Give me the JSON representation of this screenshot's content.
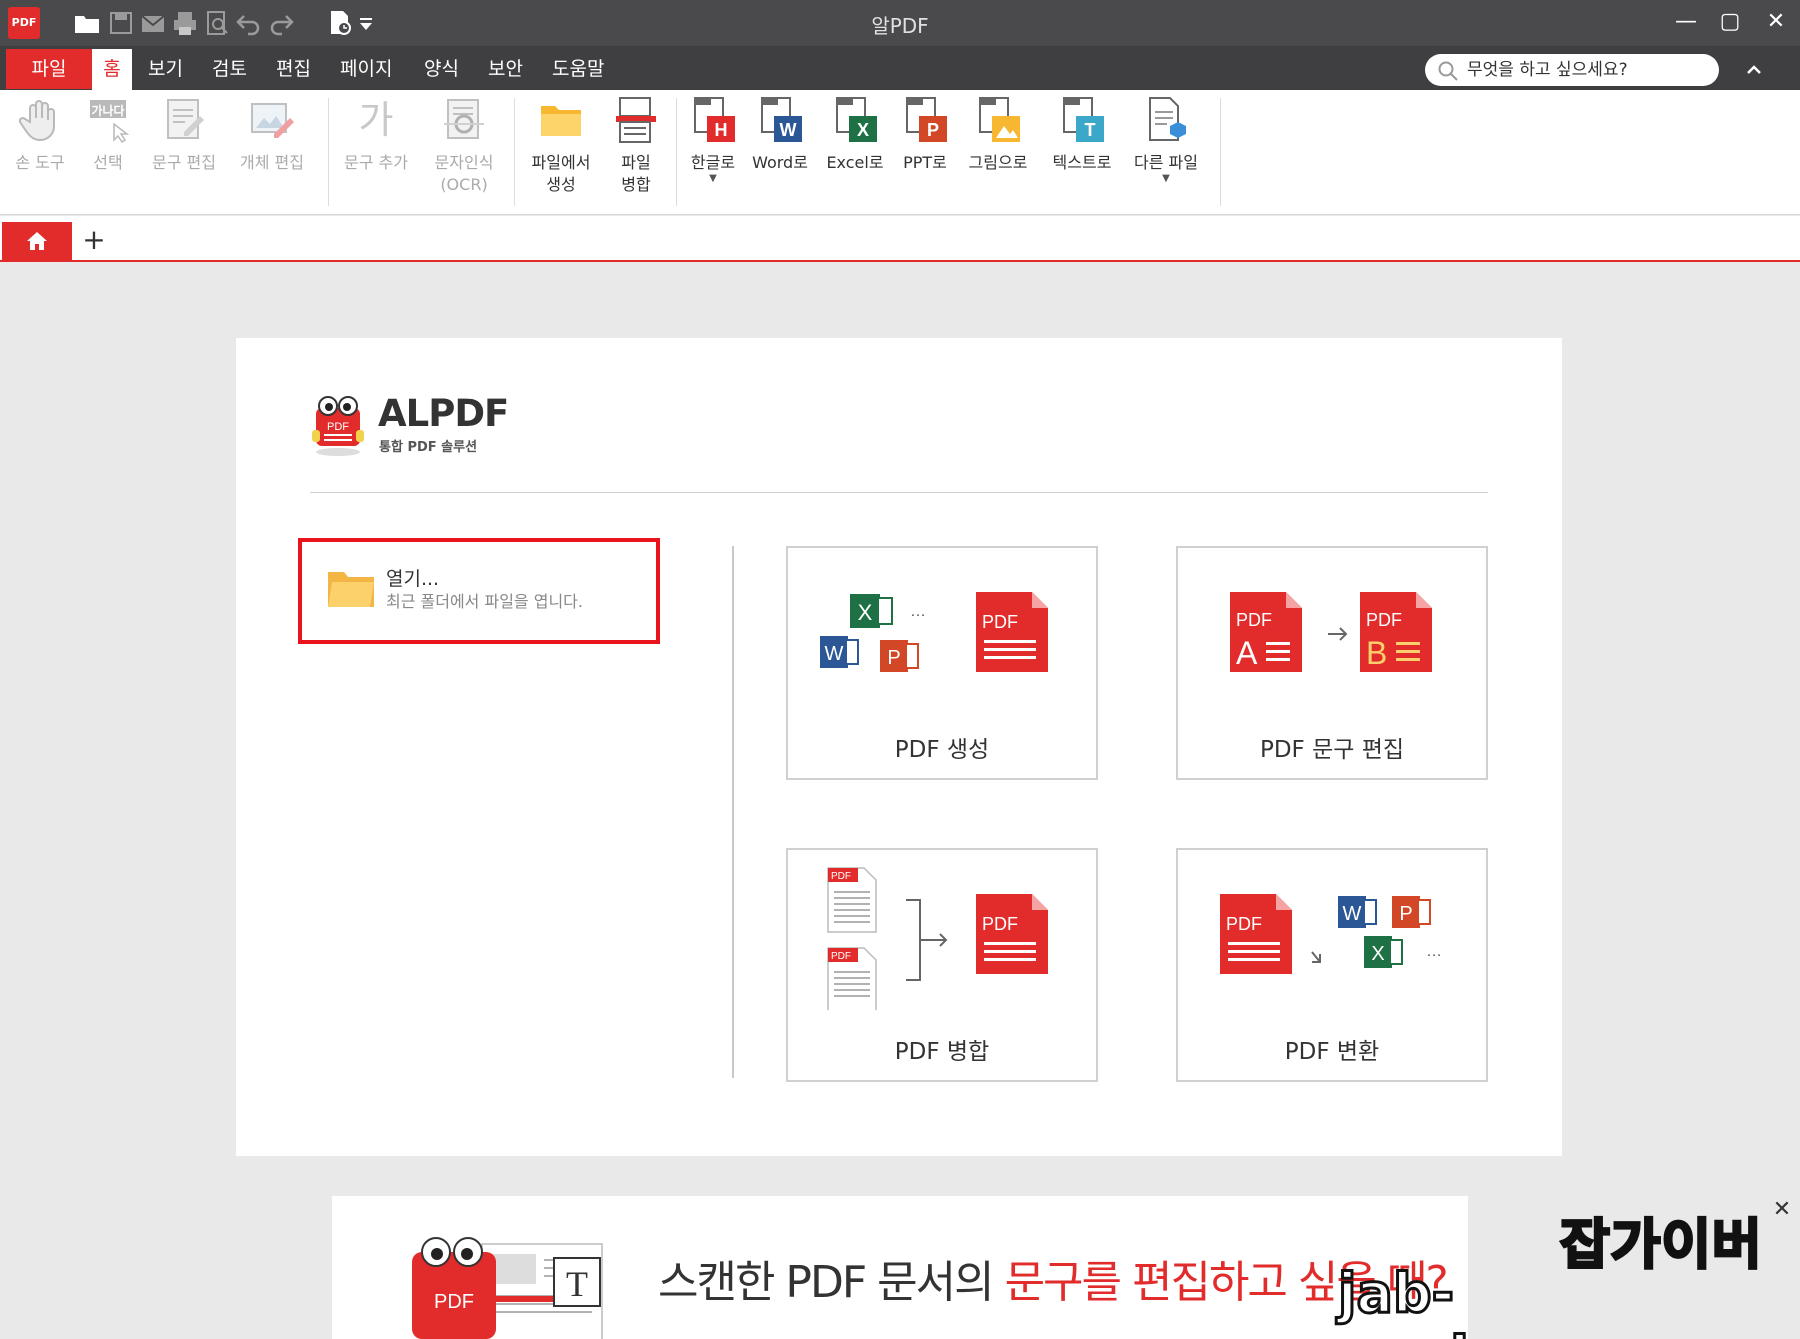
{
  "window": {
    "title": "알PDF",
    "app_logo_text": "PDF",
    "minimize": "—",
    "maximize": "▢",
    "close": "✕"
  },
  "menu": {
    "file": "파일",
    "home": "홈",
    "tabs": [
      "보기",
      "검토",
      "편집",
      "페이지",
      "양식",
      "보안",
      "도움말"
    ],
    "search_placeholder": "무엇을 하고 싶으세요?"
  },
  "ribbon": {
    "hand_tool": "손 도구",
    "select": "선택",
    "select_badge": "가나다",
    "text_edit": "문구 편집",
    "object_edit": "개체 편집",
    "add_text": "문구 추가",
    "add_text_glyph": "가",
    "ocr_line1": "문자인식",
    "ocr_line2": "(OCR)",
    "create_from_file_line1": "파일에서",
    "create_from_file_line2": "생성",
    "merge_line1": "파일",
    "merge_line2": "병합",
    "to_hwp": "한글로",
    "to_word": "Word로",
    "to_excel": "Excel로",
    "to_ppt": "PPT로",
    "to_image": "그림으로",
    "to_text": "텍스트로",
    "other_file": "다른 파일"
  },
  "start": {
    "brand_name": "ALPDF",
    "brand_sub": "통합 PDF 솔루션",
    "open_title": "열기...",
    "open_sub": "최근 폴더에서 파일을 엽니다.",
    "cards": {
      "create": "PDF 생성",
      "text_edit": "PDF 문구 편집",
      "merge": "PDF 병합",
      "convert": "PDF 변환"
    }
  },
  "ad": {
    "text_dark": "스캔한 PDF 문서의 ",
    "text_red": "문구를 편집하고 싶을 때?",
    "close": "✕"
  },
  "watermark": {
    "line1": "잡가이버",
    "line2": "jab-guyber.com"
  },
  "colors": {
    "accent": "#e22b2b",
    "titlebar": "#4a4a4c",
    "menubar": "#3f3f41",
    "workspace": "#e9e9e9"
  }
}
